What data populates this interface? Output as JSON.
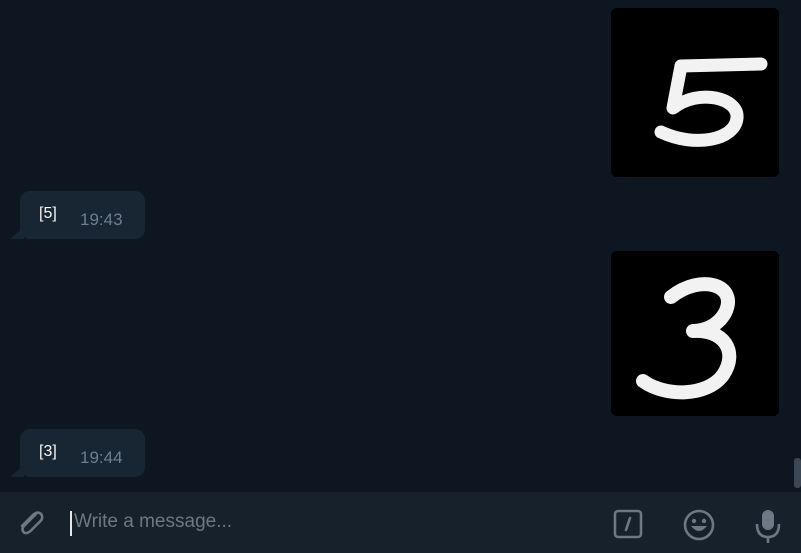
{
  "messages": [
    {
      "type": "image",
      "digit_shown": "5",
      "icon": "handwritten-digit-image"
    },
    {
      "type": "text",
      "text": "[5]",
      "time": "19:43"
    },
    {
      "type": "image",
      "digit_shown": "3",
      "icon": "handwritten-digit-image"
    },
    {
      "type": "text",
      "text": "[3]",
      "time": "19:44"
    }
  ],
  "composer": {
    "placeholder": "Write a message...",
    "icons": [
      "paperclip-icon",
      "bot-command-icon",
      "emoji-icon",
      "microphone-icon"
    ]
  },
  "colors": {
    "chat_background": "#0e1621",
    "incoming_bubble": "#182533",
    "composer_background": "#17212b",
    "time_text": "#6d7f8f",
    "icon": "#6c7883"
  }
}
